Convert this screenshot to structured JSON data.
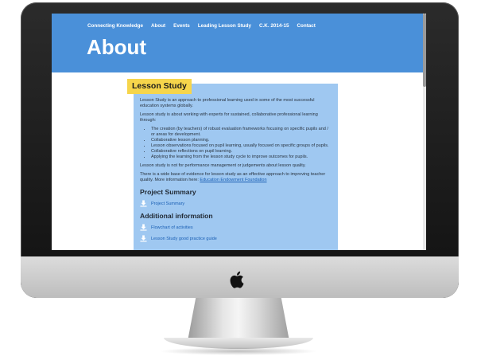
{
  "nav": {
    "items": [
      "Connecting Knowledge",
      "About",
      "Events",
      "Leading Lesson Study",
      "C.K. 2014-15",
      "Contact"
    ]
  },
  "hero": {
    "title": "About"
  },
  "panel": {
    "badge": "Lesson Study",
    "paragraphs": [
      "Lesson Study is an approach to professional learning used in some of the most successful education systems globally.",
      "Lesson study is about working with experts for sustained, collaborative professional learning through:"
    ],
    "bullets": [
      "The creation (by teachers) of robust evaluation frameworks focusing on specific pupils and / or areas for development.",
      "Collaborative lesson planning.",
      "Lesson observations focused on pupil learning, usually focused on specific groups of pupils.",
      "Collaborative reflections on pupil learning.",
      "Applying the learning from the lesson study cycle to improve outcomes for pupils."
    ],
    "note": "Lesson study is not for performance management or judgements about lesson quality.",
    "evidence_text": "There is a wide base of evidence for lesson study as an effective approach to improving teacher quality. More information here:",
    "evidence_link": "Education Endowment Foundation",
    "project_summary_heading": "Project Summary",
    "project_summary_link": "Project Summary",
    "additional_heading": "Additional information",
    "additional_links": [
      "Flowchart of activities",
      "Lesson Study good practice guide"
    ]
  },
  "colors": {
    "header": "#4a90d9",
    "panel": "#9fc8f1",
    "badge": "#f6d54b",
    "link": "#1a5fb4"
  }
}
